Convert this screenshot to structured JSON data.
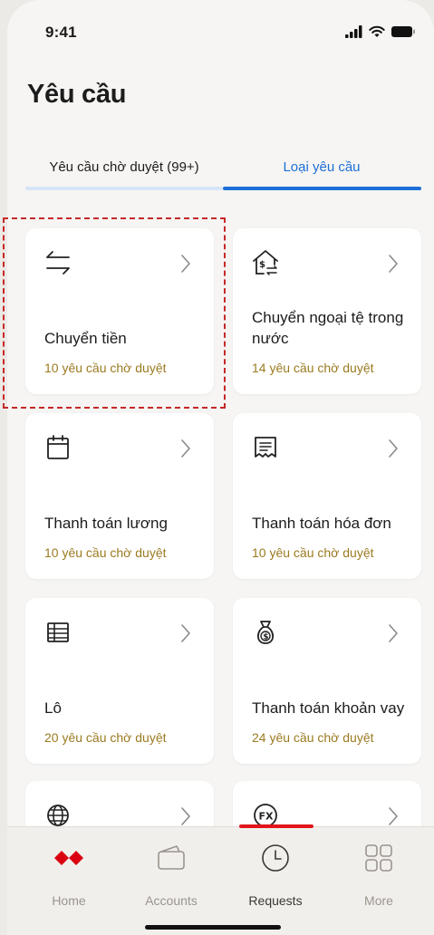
{
  "status_bar": {
    "time": "9:41"
  },
  "header": {
    "title": "Yêu cầu"
  },
  "tabs": [
    {
      "label": "Yêu cầu chờ duyệt (99+)",
      "active": false
    },
    {
      "label": "Loại yêu cầu",
      "active": true
    }
  ],
  "cards": [
    {
      "icon": "transfer-arrows-icon",
      "title": "Chuyển tiền",
      "subtitle": "10 yêu cầu chờ duyệt"
    },
    {
      "icon": "house-currency-icon",
      "title": "Chuyển ngoại tệ trong nước",
      "subtitle": "14 yêu cầu chờ duyệt"
    },
    {
      "icon": "calendar-icon",
      "title": "Thanh toán lương",
      "subtitle": "10 yêu cầu chờ duyệt"
    },
    {
      "icon": "receipt-icon",
      "title": "Thanh toán hóa đơn",
      "subtitle": "10 yêu cầu chờ duyệt"
    },
    {
      "icon": "table-icon",
      "title": "Lô",
      "subtitle": "20 yêu cầu chờ duyệt"
    },
    {
      "icon": "money-bag-icon",
      "title": "Thanh toán khoản vay",
      "subtitle": "24 yêu cầu chờ duyệt"
    },
    {
      "icon": "globe-icon",
      "title": "",
      "subtitle": ""
    },
    {
      "icon": "fx-icon",
      "title": "",
      "subtitle": ""
    }
  ],
  "tab_bar": {
    "items": [
      {
        "label": "Home",
        "icon": "hsbc-logo-icon"
      },
      {
        "label": "Accounts",
        "icon": "wallet-icon"
      },
      {
        "label": "Requests",
        "icon": "clock-icon",
        "active": true
      },
      {
        "label": "More",
        "icon": "grid-icon"
      }
    ]
  },
  "colors": {
    "accent_blue": "#1d6fd8",
    "subtitle_gold": "#9b7a20",
    "brand_red": "#db0011",
    "highlight_red": "#c62828"
  }
}
